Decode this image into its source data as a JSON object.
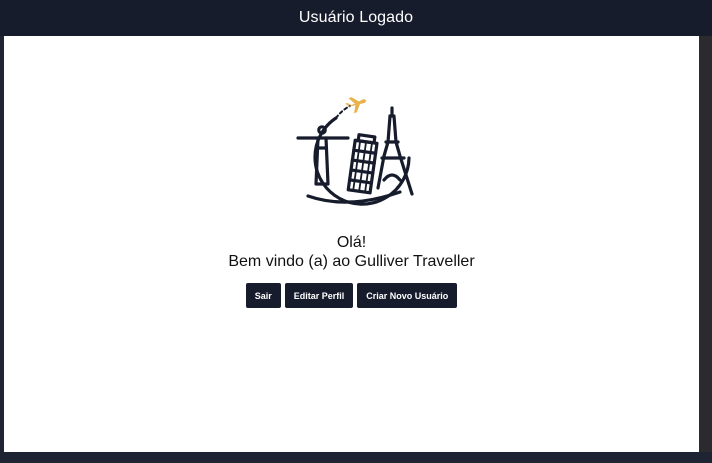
{
  "header": {
    "title": "Usuário Logado"
  },
  "main": {
    "logo_icon": "travel-landmarks-logo-icon",
    "greeting": "Olá!",
    "welcome": "Bem vindo (a) ao Gulliver Traveller",
    "buttons": {
      "logout_label": "Sair",
      "edit_profile_label": "Editar Perfil",
      "create_user_label": "Criar Novo Usuário"
    }
  },
  "colors": {
    "navy": "#171c2c",
    "accent": "#e9b14c",
    "background": "#ffffff"
  }
}
